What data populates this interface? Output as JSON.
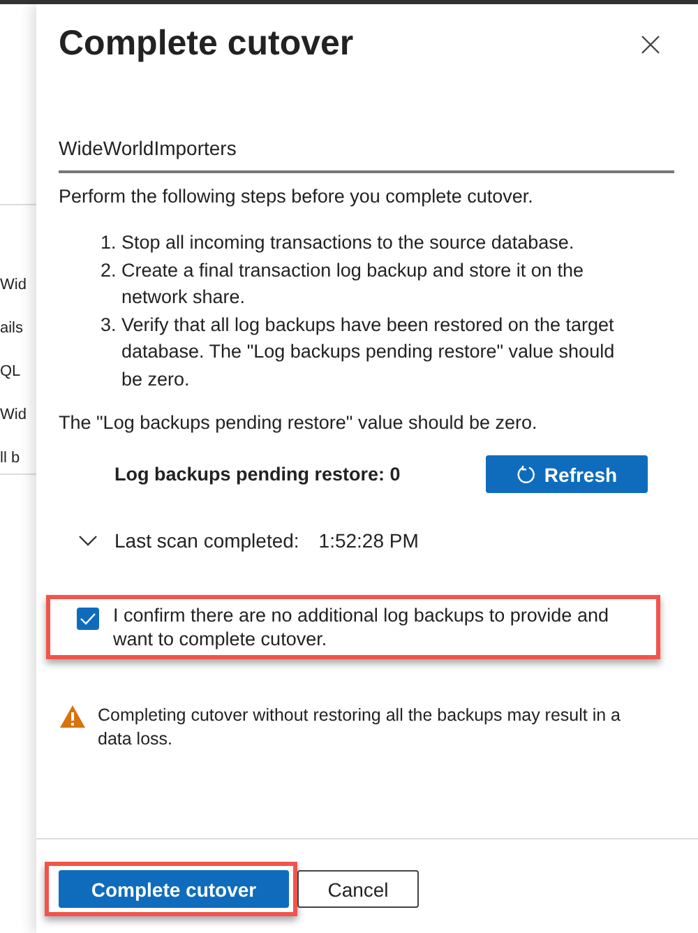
{
  "background_items": [
    "Wid",
    "ails",
    "QL",
    "Wid",
    "ll b"
  ],
  "panel": {
    "title": "Complete cutover",
    "database": "WideWorldImporters",
    "intro": "Perform the following steps before you complete cutover.",
    "steps": [
      {
        "number": "1.",
        "text": "Stop all incoming transactions to the source database."
      },
      {
        "number": "2.",
        "text": "Create a final transaction log backup and store it on the network share."
      },
      {
        "number": "3.",
        "text": "Verify that all log backups have been restored on the target database. The \"Log backups pending restore\" value should be zero."
      }
    ],
    "note": "The \"Log backups pending restore\" value should be zero.",
    "pending_label": "Log backups pending restore: 0",
    "refresh_button": "Refresh",
    "scan": {
      "expanded": false,
      "label": "Last scan completed:",
      "time": "1:52:28 PM"
    },
    "confirm": {
      "checked": true,
      "highlighted": true,
      "label": "I confirm there are no additional log backups to provide and want to complete cutover."
    },
    "warning": "Completing cutover without restoring all the backups may result in a data loss.",
    "buttons": [
      {
        "label": "Complete cutover",
        "kind": "primary",
        "highlighted": true
      },
      {
        "label": "Cancel",
        "kind": "secondary",
        "highlighted": false
      }
    ]
  }
}
